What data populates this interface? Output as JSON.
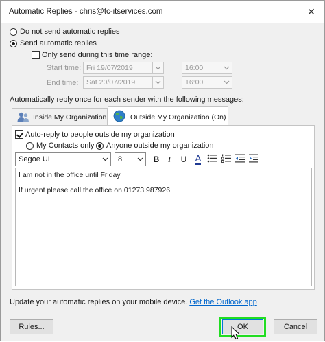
{
  "window": {
    "title": "Automatic Replies - chris@tc-itservices.com",
    "close_glyph": "✕"
  },
  "options": {
    "do_not_send_label": "Do not send automatic replies",
    "send_label": "Send automatic replies",
    "send_selected": true,
    "time_range_label": "Only send during this time range:",
    "time_range_checked": false
  },
  "time": {
    "start_label": "Start time:",
    "start_date": "Fri 19/07/2019",
    "start_time": "16:00",
    "end_label": "End time:",
    "end_date": "Sat 20/07/2019",
    "end_time": "16:00"
  },
  "instructions": "Automatically reply once for each sender with the following messages:",
  "tabs": [
    {
      "label": "Inside My Organization",
      "icon": "people-icon",
      "active": false
    },
    {
      "label": "Outside My Organization (On)",
      "icon": "globe-icon",
      "active": true
    }
  ],
  "outside": {
    "auto_reply_label": "Auto-reply to people outside my organization",
    "auto_reply_checked": true,
    "my_contacts_label": "My Contacts only",
    "anyone_label": "Anyone outside my organization",
    "anyone_selected": true
  },
  "toolbar": {
    "font": "Segoe UI",
    "size": "8",
    "bold_label": "B",
    "italic_label": "I",
    "underline_label": "U",
    "font_color_label": "A",
    "font_color": "#1f3a93"
  },
  "message": {
    "line1": "I am not in the office until Friday",
    "line2": "If urgent please call the office on 01273 987926"
  },
  "footer": {
    "mobile_text": "Update your automatic replies on your mobile device.",
    "app_link": "Get the Outlook app",
    "rules_label": "Rules...",
    "ok_label": "OK",
    "cancel_label": "Cancel"
  },
  "colors": {
    "accent": "#0078d7",
    "highlight": "#22dd22",
    "link": "#0066cc"
  }
}
